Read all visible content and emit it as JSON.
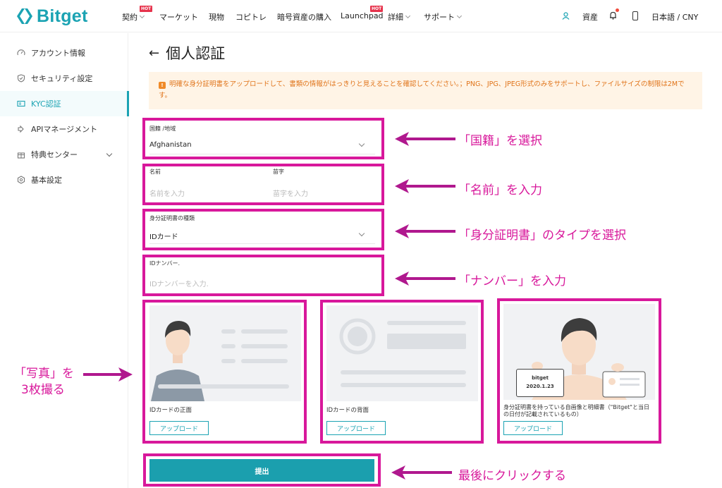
{
  "brand": {
    "name": "Bitget",
    "accent": "#1ba3b3",
    "annotation_color": "#d8189b"
  },
  "nav": {
    "items": [
      {
        "label": "契約",
        "hot": true,
        "dropdown": true
      },
      {
        "label": "マーケット"
      },
      {
        "label": "現物"
      },
      {
        "label": "コピトレ"
      },
      {
        "label": "暗号資産の購入"
      },
      {
        "label": "Launchpad",
        "hot": true
      },
      {
        "label": "詳細",
        "dropdown": true
      },
      {
        "label": "サポート",
        "dropdown": true
      }
    ],
    "hot_badge": "HOT",
    "assets": "資産",
    "language": "日本語 / CNY"
  },
  "sidebar": {
    "items": [
      {
        "label": "アカウント情報",
        "icon": "speedometer-icon"
      },
      {
        "label": "セキュリティ設定",
        "icon": "shield-icon"
      },
      {
        "label": "KYC認証",
        "icon": "id-card-icon",
        "active": true
      },
      {
        "label": "APIマネージメント",
        "icon": "api-icon"
      },
      {
        "label": "特典センター",
        "icon": "gift-icon",
        "expandable": true
      },
      {
        "label": "基本設定",
        "icon": "settings-icon"
      }
    ]
  },
  "page": {
    "title": "個人認証",
    "notice": "明確な身分証明書をアップロードして、書類の情報がはっきりと見えることを確認してください。；PNG、JPG、JPEG形式のみをサポートし、ファイルサイズの制限は2Mです。"
  },
  "form": {
    "nationality": {
      "label": "国籍 /地域",
      "value": "Afghanistan"
    },
    "first_name": {
      "label": "名前",
      "placeholder": "名前を入力"
    },
    "last_name": {
      "label": "苗字",
      "placeholder": "苗字を入力"
    },
    "id_type": {
      "label": "身分証明書の種類",
      "value": "IDカード"
    },
    "id_number": {
      "label": "IDナンバー.",
      "placeholder": "IDナンバーを入力."
    },
    "uploads": [
      {
        "caption": "IDカードの正面",
        "button": "アップロード"
      },
      {
        "caption": "IDカードの背面",
        "button": "アップロード"
      },
      {
        "caption": "身分証明書を持っている自画像と明細書（\"Bitget\"と当日の日付が記載されているもの）",
        "button": "アップロード",
        "sign_line1": "bitget",
        "sign_line2": "2020.1.23"
      }
    ],
    "submit": "提出"
  },
  "annotations": {
    "nationality": "「国籍」を選択",
    "name": "「名前」を入力",
    "id_type": "「身分証明書」のタイプを選択",
    "id_number": "「ナンバー」を入力",
    "photos_line1": "「写真」を",
    "photos_line2": "3枚撮る",
    "submit": "最後にクリックする"
  }
}
